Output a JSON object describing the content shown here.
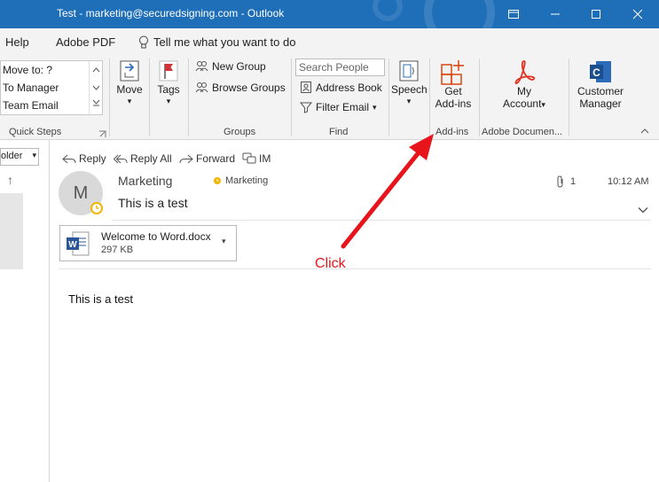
{
  "window": {
    "title": "Test - marketing@securedsigning.com  -  Outlook",
    "controls": [
      "restore",
      "minimize",
      "maximize",
      "close"
    ]
  },
  "menu": {
    "items": [
      "Help",
      "Adobe PDF"
    ],
    "tell_me": "Tell me what you want to do"
  },
  "ribbon": {
    "quick_steps": {
      "items": [
        "Move to: ?",
        "To Manager",
        "Team Email"
      ],
      "label": "Quick Steps"
    },
    "move": {
      "label": "Move"
    },
    "tags": {
      "label": "Tags"
    },
    "groups": {
      "new_group": "New Group",
      "browse_groups": "Browse Groups",
      "label": "Groups"
    },
    "find": {
      "search_placeholder": "Search People",
      "address_book": "Address Book",
      "filter_email": "Filter Email",
      "label": "Find"
    },
    "speech": {
      "label": "Speech"
    },
    "addins": {
      "line1": "Get",
      "line2": "Add-ins",
      "label": "Add-ins"
    },
    "adobe": {
      "line1": "My",
      "line2": "Account",
      "label": "Adobe Documen..."
    },
    "customer": {
      "line1": "Customer",
      "line2": "Manager"
    }
  },
  "left_pane": {
    "folder_dropdown": "older"
  },
  "message": {
    "actions": [
      "Reply",
      "Reply All",
      "Forward",
      "IM"
    ],
    "avatar_initial": "M",
    "sender": "Marketing",
    "recipient": "Marketing",
    "subject": "This is a test",
    "attachment_count": "1",
    "time": "10:12 AM",
    "attachment": {
      "name": "Welcome to Word.docx",
      "size": "297 KB"
    },
    "body": "This is a test"
  },
  "annotation": {
    "label": "Click",
    "color": "#e8141c"
  },
  "colors": {
    "titlebar": "#1f6fb8",
    "office_red": "#d83b01",
    "word_blue": "#2b579a",
    "adobe_red": "#e0301e",
    "presence": "#f2b600"
  }
}
